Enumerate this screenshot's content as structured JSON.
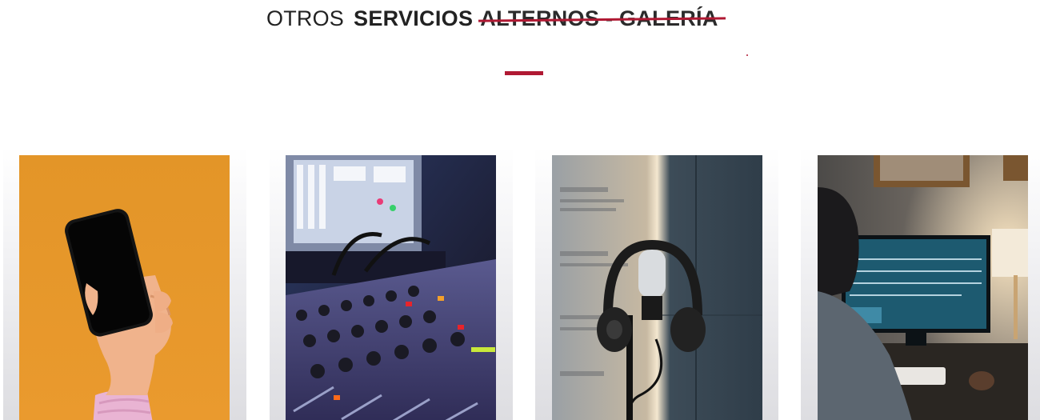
{
  "section": {
    "title_light": "OTROS",
    "title_bold": "SERVICIOS",
    "title_struck": "ALTERNOS - GALERÍA",
    "accent_color": "#b01933"
  },
  "gallery": [
    {
      "subject": "hand-holding-smartphone",
      "background": "#e9962a"
    },
    {
      "subject": "audio-mixing-console",
      "background": "#1b1f3a"
    },
    {
      "subject": "studio-microphone-with-headphones",
      "background": "#3e4d5a"
    },
    {
      "subject": "person-editing-audio-at-computer",
      "background": "#2a2f35"
    }
  ]
}
